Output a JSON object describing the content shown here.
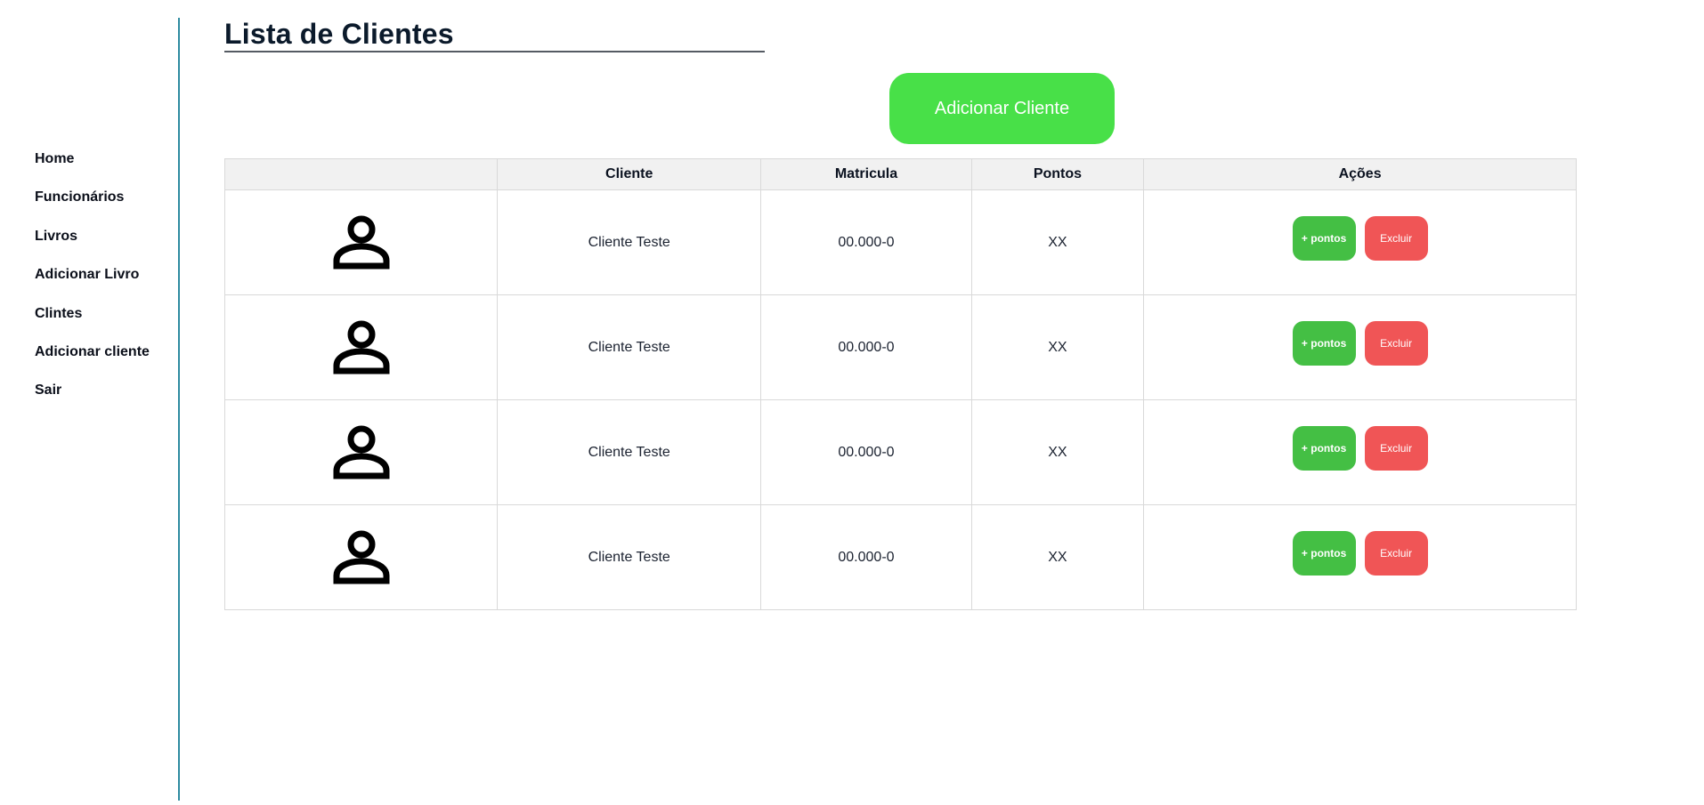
{
  "sidebar": {
    "items": [
      {
        "label": "Home"
      },
      {
        "label": "Funcionários"
      },
      {
        "label": "Livros"
      },
      {
        "label": "Adicionar Livro"
      },
      {
        "label": "Clintes"
      },
      {
        "label": "Adicionar cliente"
      },
      {
        "label": "Sair"
      }
    ]
  },
  "page": {
    "title": "Lista de Clientes",
    "add_button_label": "Adicionar Cliente"
  },
  "table": {
    "headers": [
      "",
      "Cliente",
      "Matricula",
      "Pontos",
      "Ações"
    ],
    "rows": [
      {
        "avatar_icon": "person-icon",
        "cliente": "Cliente Teste",
        "matricula": "00.000-0",
        "pontos": "XX",
        "add_points_label": "+ pontos",
        "delete_label": "Excluir"
      },
      {
        "avatar_icon": "person-icon",
        "cliente": "Cliente Teste",
        "matricula": "00.000-0",
        "pontos": "XX",
        "add_points_label": "+ pontos",
        "delete_label": "Excluir"
      },
      {
        "avatar_icon": "person-icon",
        "cliente": "Cliente Teste",
        "matricula": "00.000-0",
        "pontos": "XX",
        "add_points_label": "+ pontos",
        "delete_label": "Excluir"
      },
      {
        "avatar_icon": "person-icon",
        "cliente": "Cliente Teste",
        "matricula": "00.000-0",
        "pontos": "XX",
        "add_points_label": "+ pontos",
        "delete_label": "Excluir"
      }
    ]
  },
  "colors": {
    "sidebar_border": "#2e8ba0",
    "add_button": "#48e048",
    "points_button": "#44bf44",
    "delete_button": "#f05556",
    "header_bg": "#f1f1f1"
  }
}
